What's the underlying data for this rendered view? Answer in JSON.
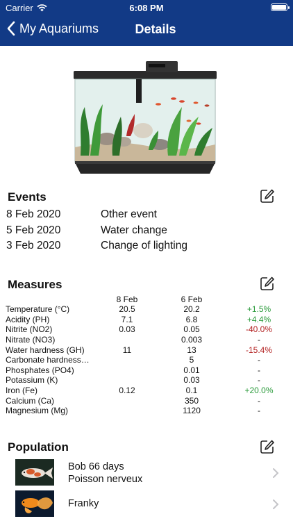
{
  "status": {
    "carrier": "Carrier",
    "time": "6:08 PM"
  },
  "nav": {
    "back_label": "My Aquariums",
    "title": "Details"
  },
  "events": {
    "title": "Events",
    "items": [
      {
        "date": "8 Feb 2020",
        "label": "Other event"
      },
      {
        "date": "5 Feb 2020",
        "label": "Water change"
      },
      {
        "date": "3 Feb 2020",
        "label": "Change of lighting"
      }
    ]
  },
  "measures": {
    "title": "Measures",
    "col1": "8 Feb",
    "col2": "6 Feb",
    "rows": [
      {
        "name": "Temperature (°C)",
        "v1": "20.5",
        "v2": "20.2",
        "pct": "+1.5%",
        "trend": "pos"
      },
      {
        "name": "Acidity (PH)",
        "v1": "7.1",
        "v2": "6.8",
        "pct": "+4.4%",
        "trend": "pos"
      },
      {
        "name": "Nitrite (NO2)",
        "v1": "0.03",
        "v2": "0.05",
        "pct": "-40.0%",
        "trend": "neg"
      },
      {
        "name": "Nitrate (NO3)",
        "v1": "",
        "v2": "0.003",
        "pct": "-",
        "trend": "none"
      },
      {
        "name": "Water hardness (GH)",
        "v1": "11",
        "v2": "13",
        "pct": "-15.4%",
        "trend": "neg"
      },
      {
        "name": "Carbonate hardness…",
        "v1": "",
        "v2": "5",
        "pct": "-",
        "trend": "none"
      },
      {
        "name": "Phosphates (PO4)",
        "v1": "",
        "v2": "0.01",
        "pct": "-",
        "trend": "none"
      },
      {
        "name": "Potassium (K)",
        "v1": "",
        "v2": "0.03",
        "pct": "-",
        "trend": "none"
      },
      {
        "name": "Iron (Fe)",
        "v1": "0.12",
        "v2": "0.1",
        "pct": "+20.0%",
        "trend": "pos"
      },
      {
        "name": "Calcium (Ca)",
        "v1": "",
        "v2": "350",
        "pct": "-",
        "trend": "none"
      },
      {
        "name": "Magnesium (Mg)",
        "v1": "",
        "v2": "1120",
        "pct": "-",
        "trend": "none"
      }
    ]
  },
  "population": {
    "title": "Population",
    "items": [
      {
        "line1": "Bob 66 days",
        "line2": "Poisson nerveux",
        "fish": "koi-fish"
      },
      {
        "line1": "Franky",
        "line2": "",
        "fish": "goldfish"
      }
    ]
  },
  "icons": {
    "back": "chevron-left-icon",
    "edit": "square-pencil-icon",
    "disclosure": "chevron-right-icon",
    "wifi": "wifi-icon",
    "battery": "battery-icon"
  },
  "colors": {
    "nav_bg": "#123a86",
    "positive": "#2a9a3a",
    "negative": "#b11d1d"
  }
}
